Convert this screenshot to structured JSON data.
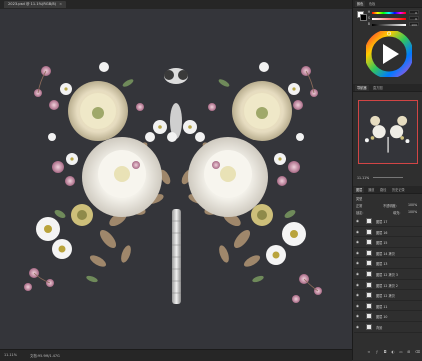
{
  "document": {
    "tab_title": "2023.psd @ 11.1%(RGB/8)",
    "close_glyph": "×"
  },
  "status": {
    "zoom": "11.11%",
    "doc_info": "文档:95.9M/1.47G"
  },
  "color_panel": {
    "tabs": [
      "颜色",
      "色板"
    ],
    "sliders": [
      {
        "label": "H",
        "value": "0"
      },
      {
        "label": "S",
        "value": "0"
      },
      {
        "label": "B",
        "value": "100"
      }
    ],
    "foreground_color": "#ffffff",
    "background_color": "#000000"
  },
  "navigator_panel": {
    "tabs": [
      "导航器",
      "直方图"
    ],
    "zoom": "11.11%"
  },
  "layers_panel": {
    "tabs": [
      "图层",
      "通道",
      "路径",
      "历史记录"
    ],
    "kind_label": "类型",
    "blend_mode": "正常",
    "opacity_label": "不透明度:",
    "opacity": "100%",
    "lock_label": "锁定:",
    "fill_label": "填充:",
    "fill": "100%",
    "layers": [
      {
        "name": "图层 17",
        "selected": false
      },
      {
        "name": "图层 16",
        "selected": false
      },
      {
        "name": "图层 15",
        "selected": false
      },
      {
        "name": "图层 14 拷贝",
        "selected": false
      },
      {
        "name": "图层 13",
        "selected": false
      },
      {
        "name": "图层 12 拷贝 3",
        "selected": false
      },
      {
        "name": "图层 12 拷贝 2",
        "selected": false
      },
      {
        "name": "图层 12 拷贝",
        "selected": false
      },
      {
        "name": "图层 11",
        "selected": false
      },
      {
        "name": "图层 10",
        "selected": false
      },
      {
        "name": "背景",
        "selected": false
      }
    ],
    "bottom_icons": [
      "link-icon",
      "fx-icon",
      "mask-icon",
      "adjustment-icon",
      "folder-icon",
      "new-layer-icon",
      "trash-icon"
    ]
  },
  "colors": {
    "canvas_bg": "#34353a",
    "ui_dark": "#262626",
    "panel": "#2f2f2f",
    "accent_red": "#d24545"
  }
}
